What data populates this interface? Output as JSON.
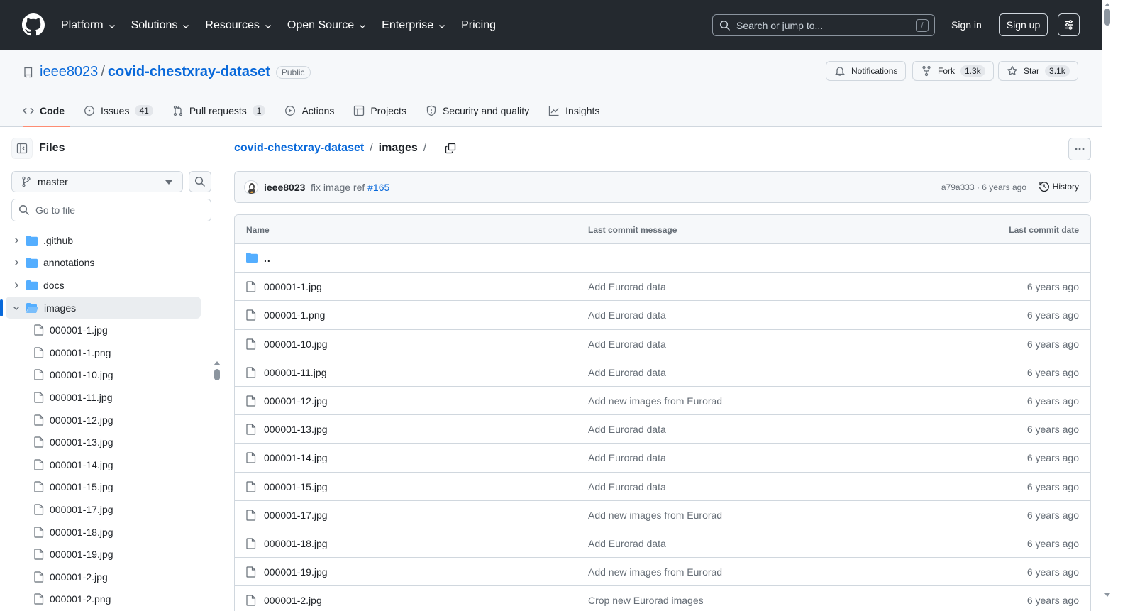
{
  "header": {
    "nav": [
      {
        "label": "Platform",
        "dropdown": true
      },
      {
        "label": "Solutions",
        "dropdown": true
      },
      {
        "label": "Resources",
        "dropdown": true
      },
      {
        "label": "Open Source",
        "dropdown": true
      },
      {
        "label": "Enterprise",
        "dropdown": true
      },
      {
        "label": "Pricing",
        "dropdown": false
      }
    ],
    "search_placeholder": "Search or jump to...",
    "search_shortcut": "/",
    "sign_in": "Sign in",
    "sign_up": "Sign up"
  },
  "repo": {
    "owner": "ieee8023",
    "separator": "/",
    "name": "covid-chestxray-dataset",
    "visibility": "Public",
    "notifications_label": "Notifications",
    "fork_label": "Fork",
    "fork_count": "1.3k",
    "star_label": "Star",
    "star_count": "3.1k",
    "tabs": [
      {
        "label": "Code",
        "icon": "code-icon",
        "count": ""
      },
      {
        "label": "Issues",
        "icon": "issue-icon",
        "count": "41"
      },
      {
        "label": "Pull requests",
        "icon": "pull-request-icon",
        "count": "1"
      },
      {
        "label": "Actions",
        "icon": "play-icon",
        "count": ""
      },
      {
        "label": "Projects",
        "icon": "table-icon",
        "count": ""
      },
      {
        "label": "Security and quality",
        "icon": "shield-icon",
        "count": ""
      },
      {
        "label": "Insights",
        "icon": "graph-icon",
        "count": ""
      }
    ]
  },
  "sidebar": {
    "title": "Files",
    "branch": "master",
    "goto_placeholder": "Go to file",
    "dirs": [
      {
        "label": ".github"
      },
      {
        "label": "annotations"
      },
      {
        "label": "docs"
      },
      {
        "label": "images"
      }
    ],
    "files": [
      "000001-1.jpg",
      "000001-1.png",
      "000001-10.jpg",
      "000001-11.jpg",
      "000001-12.jpg",
      "000001-13.jpg",
      "000001-14.jpg",
      "000001-15.jpg",
      "000001-17.jpg",
      "000001-18.jpg",
      "000001-19.jpg",
      "000001-2.jpg",
      "000001-2.png"
    ]
  },
  "main": {
    "breadcrumb_repo": "covid-chestxray-dataset",
    "breadcrumb_sep": "/",
    "breadcrumb_current": "images",
    "breadcrumb_trailing": "/",
    "commit": {
      "author": "ieee8023",
      "message": "fix image ref",
      "ref": "#165",
      "meta": "a79a333 · 6 years ago",
      "history_label": "History"
    },
    "table": {
      "col_name": "Name",
      "col_message": "Last commit message",
      "col_date": "Last commit date",
      "parent": "..",
      "rows": [
        {
          "name": "000001-1.jpg",
          "message": "Add Eurorad data",
          "date": "6 years ago"
        },
        {
          "name": "000001-1.png",
          "message": "Add Eurorad data",
          "date": "6 years ago"
        },
        {
          "name": "000001-10.jpg",
          "message": "Add Eurorad data",
          "date": "6 years ago"
        },
        {
          "name": "000001-11.jpg",
          "message": "Add Eurorad data",
          "date": "6 years ago"
        },
        {
          "name": "000001-12.jpg",
          "message": "Add new images from Eurorad",
          "date": "6 years ago"
        },
        {
          "name": "000001-13.jpg",
          "message": "Add Eurorad data",
          "date": "6 years ago"
        },
        {
          "name": "000001-14.jpg",
          "message": "Add Eurorad data",
          "date": "6 years ago"
        },
        {
          "name": "000001-15.jpg",
          "message": "Add Eurorad data",
          "date": "6 years ago"
        },
        {
          "name": "000001-17.jpg",
          "message": "Add new images from Eurorad",
          "date": "6 years ago"
        },
        {
          "name": "000001-18.jpg",
          "message": "Add Eurorad data",
          "date": "6 years ago"
        },
        {
          "name": "000001-19.jpg",
          "message": "Add new images from Eurorad",
          "date": "6 years ago"
        },
        {
          "name": "000001-2.jpg",
          "message": "Crop new Eurorad images",
          "date": "6 years ago"
        }
      ]
    }
  },
  "colors": {
    "header_bg": "#24292f",
    "link": "#0969da",
    "folder": "#54aeff",
    "active_tab_underline": "#fd8c73",
    "muted_text": "#656d76",
    "border": "#d0d7de"
  }
}
